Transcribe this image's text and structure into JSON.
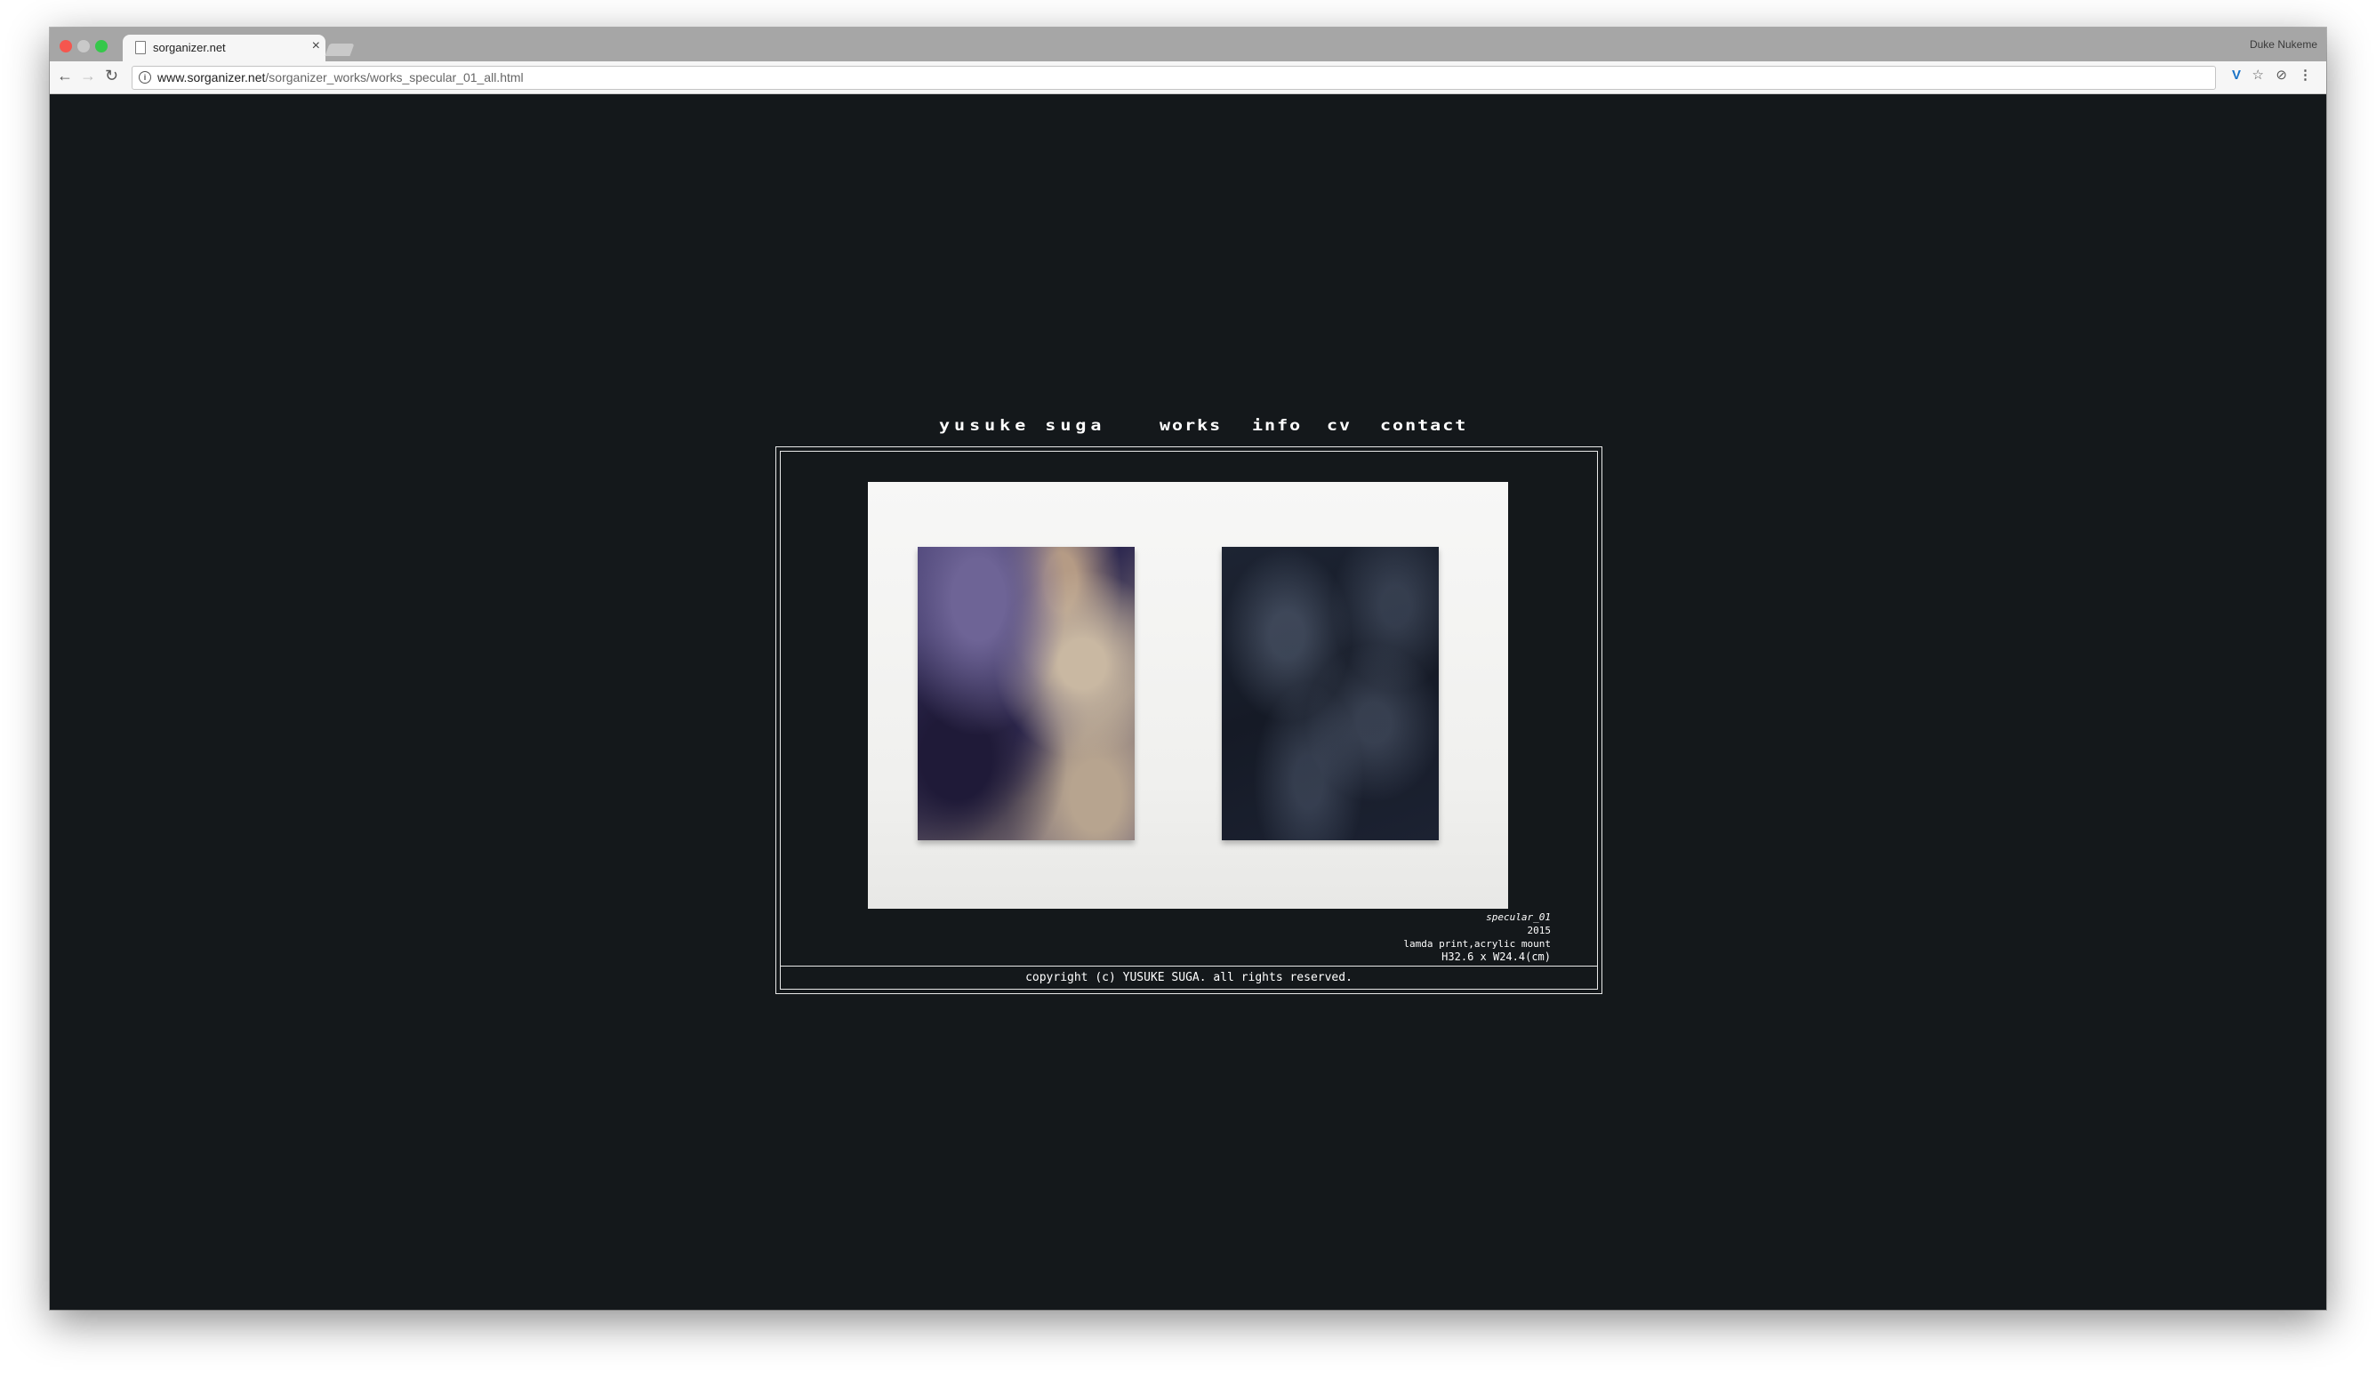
{
  "browser": {
    "tab_title": "sorganizer.net",
    "tab_close": "×",
    "profile_name": "Duke Nukeme",
    "url_domain": "www.sorganizer.net",
    "url_path": "/sorganizer_works/works_specular_01_all.html",
    "back_glyph": "←",
    "forward_glyph": "→",
    "reload_glyph": "↻",
    "info_glyph": "i",
    "ext_v_glyph": "V",
    "star_glyph": "☆",
    "shield_glyph": "⊘",
    "menu_glyph": "⋮"
  },
  "site": {
    "brand": "YUSUKE SUGA",
    "nav": {
      "works": "WORKS",
      "info": "INFO",
      "cv": "CV",
      "contact": "CONTACT"
    },
    "work": {
      "title": "specular_01",
      "year": "2015",
      "medium": "lamda print,acrylic mount",
      "size": "H32.6 x W24.4(cm)"
    },
    "copyright": "copyright (c) YUSUKE SUGA. all rights reserved."
  },
  "colors": {
    "page_background": "#14181b",
    "text": "#ffffff",
    "frame_border": "#e8e8e8"
  }
}
